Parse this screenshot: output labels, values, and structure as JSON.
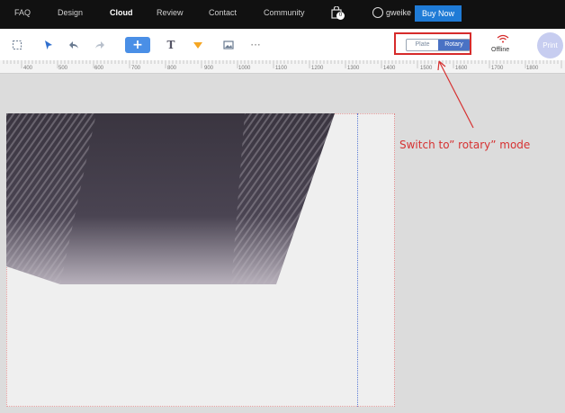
{
  "topnav": {
    "items": [
      {
        "label": "FAQ"
      },
      {
        "label": "Design"
      },
      {
        "label": "Cloud",
        "active": true
      },
      {
        "label": "Review"
      },
      {
        "label": "Contact"
      },
      {
        "label": "Community"
      }
    ],
    "cart_count": "0",
    "username": "gweike",
    "buy_now": "Buy Now"
  },
  "toolbar": {
    "icons": [
      "select-frame-icon",
      "pointer-icon",
      "undo-icon",
      "redo-icon",
      "add-icon",
      "text-icon",
      "shape-icon",
      "image-icon",
      "more-icon"
    ],
    "add_label": "+",
    "text_label": "T",
    "more_label": "···",
    "mode": {
      "plate": "Plate",
      "rotary": "Rotary",
      "selected": "Rotary"
    },
    "status": "Offline",
    "print": "Print"
  },
  "ruler": {
    "labels": [
      "400",
      "500",
      "600",
      "700",
      "800",
      "900",
      "1000",
      "1100",
      "1200",
      "1300",
      "1400",
      "1500",
      "1600",
      "1700",
      "1800"
    ]
  },
  "annotation": {
    "text": "Switch to” rotary”  mode",
    "color": "#d63232"
  },
  "colors": {
    "accent": "#4a8fe6",
    "buy_now": "#1f7bd6",
    "highlight": "#d62b2b",
    "rotary_selected": "#4a72c4"
  }
}
